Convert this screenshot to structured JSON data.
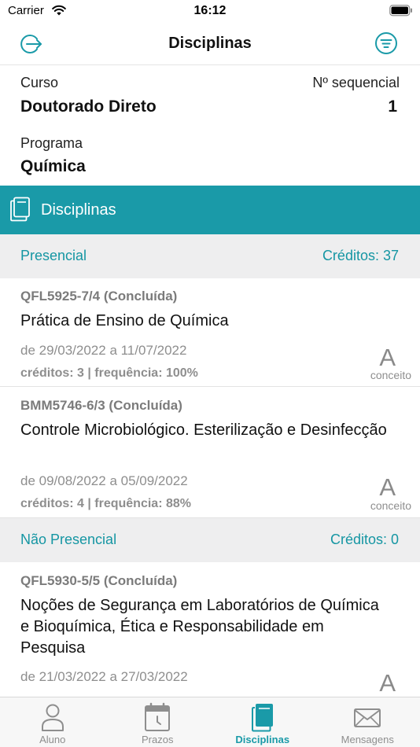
{
  "status_bar": {
    "carrier": "Carrier",
    "time": "16:12"
  },
  "nav": {
    "title": "Disciplinas",
    "left_icon": "logout-icon",
    "right_icon": "filter-icon"
  },
  "info": {
    "curso_label": "Curso",
    "curso_value": "Doutorado Direto",
    "sequencial_label": "Nº sequencial",
    "sequencial_value": "1",
    "programa_label": "Programa",
    "programa_value": "Química"
  },
  "section": {
    "title": "Disciplinas",
    "icon": "book-outline-icon"
  },
  "groups": [
    {
      "title": "Presencial",
      "credits": "Créditos: 37",
      "courses": [
        {
          "code": "QFL5925-7/4 (Concluída)",
          "name": "Prática de Ensino de Química",
          "dates": "de 29/03/2022 a 11/07/2022",
          "stats": "créditos: 3 | frequência: 100%",
          "grade": "A",
          "grade_caption": "conceito"
        },
        {
          "code": "BMM5746-6/3 (Concluída)",
          "name": "Controle Microbiológico. Esterilização e Desinfecção",
          "dates": "de 09/08/2022 a 05/09/2022",
          "stats": "créditos: 4 | frequência: 88%",
          "grade": "A",
          "grade_caption": "conceito"
        }
      ]
    },
    {
      "title": "Não Presencial",
      "credits": "Créditos: 0",
      "courses": [
        {
          "code": "QFL5930-5/5 (Concluída)",
          "name": "Noções de Segurança em Laboratórios de Química e Bioquímica, Ética e Responsabilidade em Pesquisa",
          "dates": "de 21/03/2022 a 27/03/2022",
          "grade": "A"
        }
      ]
    }
  ],
  "tabs": [
    {
      "label": "Aluno",
      "icon": "person-icon",
      "active": false
    },
    {
      "label": "Prazos",
      "icon": "calendar-icon",
      "active": false
    },
    {
      "label": "Disciplinas",
      "icon": "book-icon",
      "active": true
    },
    {
      "label": "Mensagens",
      "icon": "envelope-icon",
      "active": false
    }
  ],
  "colors": {
    "accent": "#1a9aa8",
    "group_background": "#eeeeef",
    "tab_inactive": "#8e8e8e"
  }
}
